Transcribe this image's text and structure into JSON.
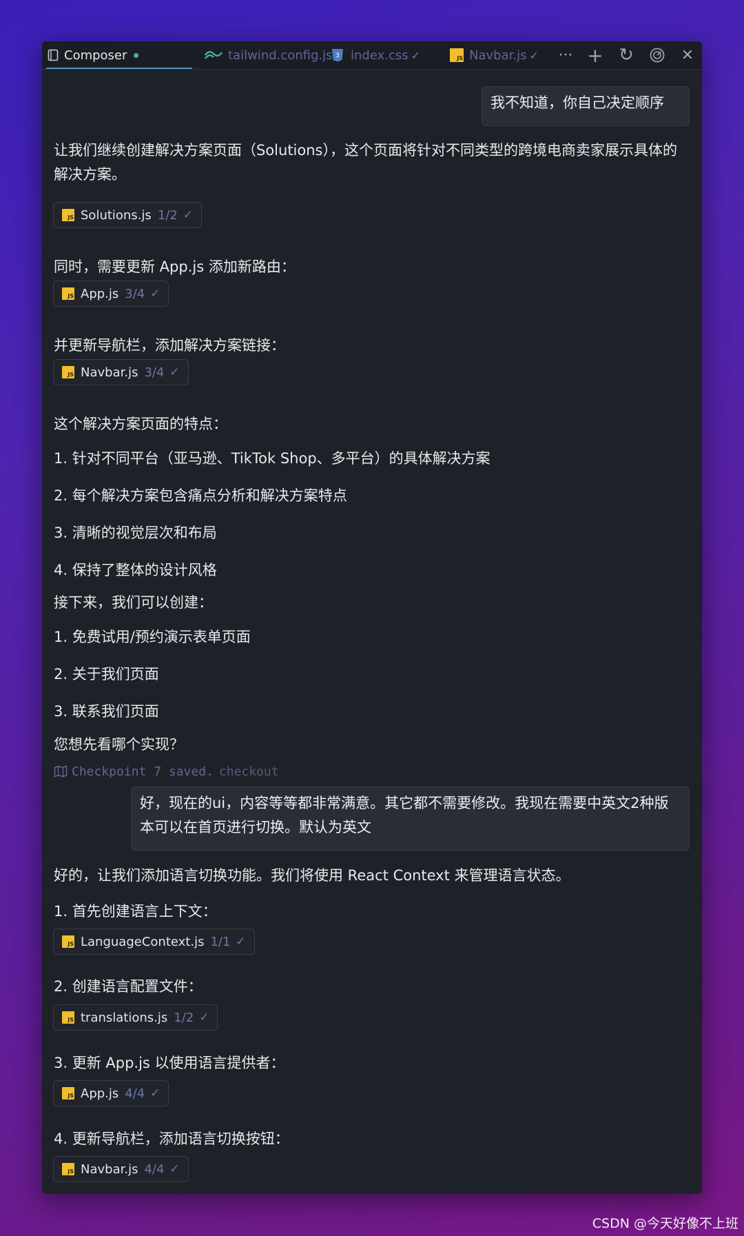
{
  "tabs": [
    {
      "label": "Composer",
      "icon": "notebook-icon",
      "status": "dot",
      "active": true
    },
    {
      "label": "tailwind.config.js",
      "icon": "tailwind-icon",
      "status": "✓"
    },
    {
      "label": "index.css",
      "icon": "css-icon",
      "status": "✓"
    },
    {
      "label": "Navbar.js",
      "icon": "js-icon",
      "status": "✓"
    }
  ],
  "toolbar": {
    "more": "···",
    "add": "+",
    "refresh": "↻",
    "history": "◎",
    "close": "✕"
  },
  "messages": {
    "user1": "我不知道，你自己决定顺序",
    "intro": "让我们继续创建解决方案页面（Solutions），这个页面将针对不同类型的跨境电商卖家展示具体的解决方案。",
    "chip1": {
      "file": "Solutions.js",
      "progress": "1/2",
      "check": "✓"
    },
    "update_app": "同时，需要更新 App.js 添加新路由：",
    "chip2": {
      "file": "App.js",
      "progress": "3/4",
      "check": "✓"
    },
    "update_nav": "并更新导航栏，添加解决方案链接：",
    "chip3": {
      "file": "Navbar.js",
      "progress": "3/4",
      "check": "✓"
    },
    "features_title": "这个解决方案页面的特点：",
    "features": [
      "1. 针对不同平台（亚马逊、TikTok Shop、多平台）的具体解决方案",
      "2. 每个解决方案包含痛点分析和解决方案特点",
      "3. 清晰的视觉层次和布局",
      "4. 保持了整体的设计风格"
    ],
    "next_title": "接下来，我们可以创建：",
    "next": [
      "1. 免费试用/预约演示表单页面",
      "2. 关于我们页面",
      "3. 联系我们页面"
    ],
    "question": "您想先看哪个实现？",
    "checkpoint": "Checkpoint 7 saved.",
    "checkout": "checkout",
    "user2": "好，现在的ui，内容等等都非常满意。其它都不需要修改。我现在需要中英文2种版本可以在首页进行切换。默认为英文",
    "reply": "好的，让我们添加语言切换功能。我们将使用 React Context 来管理语言状态。",
    "step1": "1. 首先创建语言上下文：",
    "chip4": {
      "file": "LanguageContext.js",
      "progress": "1/1",
      "check": "✓"
    },
    "step2": "2. 创建语言配置文件：",
    "chip5": {
      "file": "translations.js",
      "progress": "1/2",
      "check": "✓"
    },
    "step3": "3. 更新 App.js 以使用语言提供者：",
    "chip6": {
      "file": "App.js",
      "progress": "4/4",
      "check": "✓"
    },
    "step4": "4. 更新导航栏，添加语言切换按钮：",
    "chip7": {
      "file": "Navbar.js",
      "progress": "4/4",
      "check": "✓"
    }
  },
  "js_badge": "JS",
  "watermark": "CSDN @今天好像不上班",
  "colors": {
    "accent": "#4a90c8",
    "js_badge": "#f0c02a",
    "panel": "#1f2129",
    "dot": "#3fb89a"
  }
}
